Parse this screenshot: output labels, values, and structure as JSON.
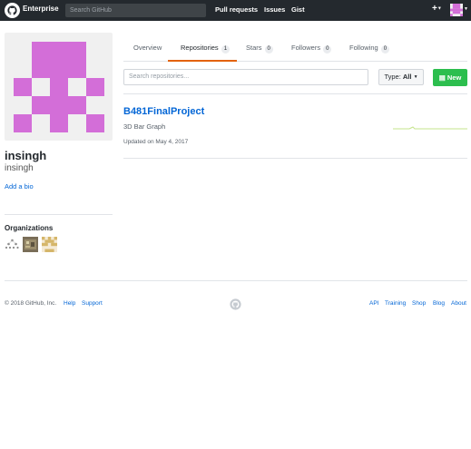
{
  "header": {
    "brand": "Enterprise",
    "search_placeholder": "Search GitHub",
    "nav": [
      "Pull requests",
      "Issues",
      "Gist"
    ],
    "plus_label": "+"
  },
  "profile": {
    "fullname": "insingh",
    "username": "insingh",
    "bio_link": "Add a bio",
    "avatar_color": "#d36ed8"
  },
  "organizations": {
    "title": "Organizations"
  },
  "tabs": [
    {
      "label": "Overview",
      "count": null
    },
    {
      "label": "Repositories",
      "count": "1"
    },
    {
      "label": "Stars",
      "count": "0"
    },
    {
      "label": "Followers",
      "count": "0"
    },
    {
      "label": "Following",
      "count": "0"
    }
  ],
  "repo_toolbar": {
    "search_placeholder": "Search repositories...",
    "type_label": "Type:",
    "type_value": "All",
    "new_button": "New"
  },
  "repos": [
    {
      "name": "B481FinalProject",
      "description": "3D Bar Graph",
      "updated": "Updated on May 4, 2017"
    }
  ],
  "footer": {
    "copyright": "© 2018 GitHub, Inc.",
    "left_links": [
      "Help",
      "Support"
    ],
    "right_links": [
      "API",
      "Training",
      "Shop",
      "Blog",
      "About"
    ]
  },
  "colors": {
    "accent_tab": "#e36209",
    "link": "#0366d6",
    "new_button": "#2cbe4e",
    "topbar": "#24292e"
  }
}
